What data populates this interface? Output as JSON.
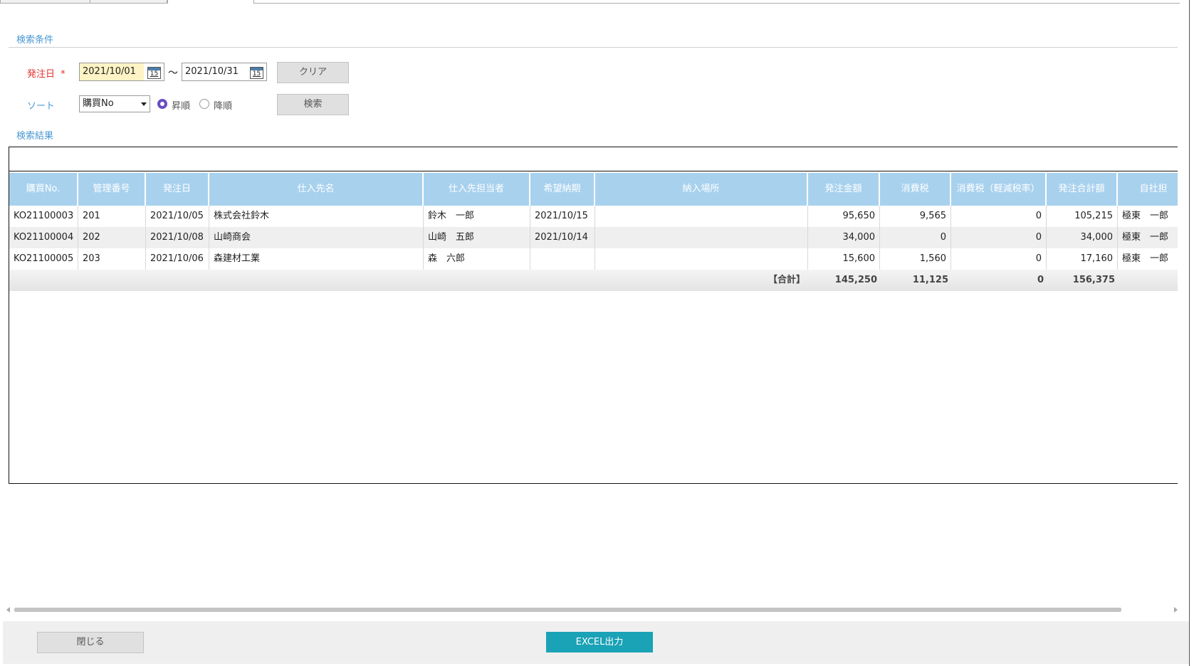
{
  "search": {
    "section_title": "検索条件",
    "order_date_label": "発注日",
    "required_mark": "*",
    "date_from": "2021/10/01",
    "date_to": "2021/10/31",
    "calendar_day": "15",
    "range_separator": "～",
    "clear_label": "クリア",
    "sort_label": "ソート",
    "sort_selected": "購買No",
    "asc_label": "昇順",
    "desc_label": "降順",
    "search_label": "検索"
  },
  "results": {
    "section_title": "検索結果",
    "columns": [
      "購買No.",
      "管理番号",
      "発注日",
      "仕入先名",
      "仕入先担当者",
      "希望納期",
      "納入場所",
      "発注金額",
      "消費税",
      "消費税（軽減税率）",
      "発注合計額",
      "自社担"
    ],
    "rows": [
      [
        "KO21100003",
        "201",
        "2021/10/05",
        "株式会社鈴木",
        "鈴木　一郎",
        "2021/10/15",
        "",
        "95,650",
        "9,565",
        "0",
        "105,215",
        "極東　一郎"
      ],
      [
        "KO21100004",
        "202",
        "2021/10/08",
        "山崎商会",
        "山崎　五郎",
        "2021/10/14",
        "",
        "34,000",
        "0",
        "0",
        "34,000",
        "極東　一郎"
      ],
      [
        "KO21100005",
        "203",
        "2021/10/06",
        "森建材工業",
        "森　六郎",
        "",
        "",
        "15,600",
        "1,560",
        "0",
        "17,160",
        "極東　一郎"
      ]
    ],
    "totals": {
      "label": "【合計】",
      "amount": "145,250",
      "tax": "11,125",
      "reduced_tax": "0",
      "grand_total": "156,375"
    }
  },
  "footer": {
    "close_label": "閉じる",
    "excel_label": "EXCEL出力"
  },
  "colors": {
    "accent_blue": "#4a98d2",
    "header_bg": "#a8d1ee",
    "required_red": "#e0312b",
    "excel_button": "#1aa2b6",
    "radio_selected": "#6a4cc4"
  },
  "icons": [
    "calendar-icon",
    "dropdown-arrow-icon",
    "scroll-left-icon",
    "scroll-right-icon"
  ]
}
